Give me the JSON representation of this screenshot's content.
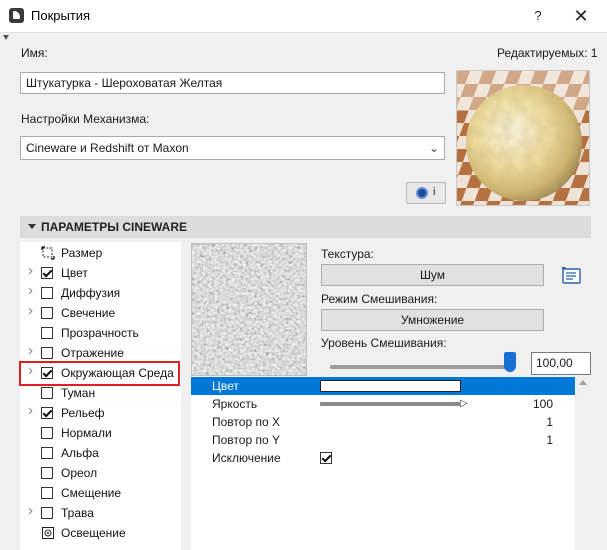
{
  "window": {
    "title": "Покрытия",
    "help_glyph": "?",
    "close_glyph": "✕"
  },
  "name_label": "Имя:",
  "editable_label": "Редактируемых: 1",
  "name_value": "Штукатурка - Шероховатая Желтая",
  "engine_label": "Настройки Механизма:",
  "engine_value": "Cineware и Redshift от Maxon",
  "engine_info_label": "i",
  "section_title": "ПАРАМЕТРЫ CINEWARE",
  "channels": [
    {
      "label": "Размер",
      "expander": false,
      "control": "icon",
      "icon": "size-icon"
    },
    {
      "label": "Цвет",
      "expander": true,
      "control": "checkbox",
      "checked": true
    },
    {
      "label": "Диффузия",
      "expander": true,
      "control": "checkbox",
      "checked": false
    },
    {
      "label": "Свечение",
      "expander": true,
      "control": "checkbox",
      "checked": false
    },
    {
      "label": "Прозрачность",
      "expander": false,
      "control": "checkbox",
      "checked": false
    },
    {
      "label": "Отражение",
      "expander": true,
      "control": "checkbox",
      "checked": false
    },
    {
      "label": "Окружающая Среда",
      "expander": true,
      "control": "checkbox",
      "checked": true,
      "highlighted": true
    },
    {
      "label": "Туман",
      "expander": false,
      "control": "checkbox",
      "checked": false
    },
    {
      "label": "Рельеф",
      "expander": true,
      "control": "checkbox",
      "checked": true
    },
    {
      "label": "Нормали",
      "expander": false,
      "control": "checkbox",
      "checked": false
    },
    {
      "label": "Альфа",
      "expander": false,
      "control": "checkbox",
      "checked": false
    },
    {
      "label": "Ореол",
      "expander": false,
      "control": "checkbox",
      "checked": false
    },
    {
      "label": "Смещение",
      "expander": false,
      "control": "checkbox",
      "checked": false
    },
    {
      "label": "Трава",
      "expander": true,
      "control": "checkbox",
      "checked": false
    },
    {
      "label": "Освещение",
      "expander": false,
      "control": "icon",
      "icon": "lighting-icon"
    }
  ],
  "texture": {
    "label": "Текстура:",
    "button": "Шум",
    "blend_mode_label": "Режим Смешивания:",
    "blend_mode_value": "Умножение",
    "blend_level_label": "Уровень Смешивания:",
    "blend_level_value": "100,00",
    "blend_level_fraction": 1.0
  },
  "properties": [
    {
      "name": "Цвет",
      "type": "color",
      "selected": true,
      "color": "#ffffff"
    },
    {
      "name": "Яркость",
      "type": "slider",
      "value": "100",
      "fraction": 1.0
    },
    {
      "name": "Повтор по X",
      "type": "number",
      "value": "1"
    },
    {
      "name": "Повтор по Y",
      "type": "number",
      "value": "1"
    },
    {
      "name": "Исключение",
      "type": "checkbox",
      "checked": true
    }
  ],
  "colors": {
    "accent": "#0078d7",
    "highlight_frame": "#e02020",
    "slider_thumb": "#1a6fd6"
  }
}
